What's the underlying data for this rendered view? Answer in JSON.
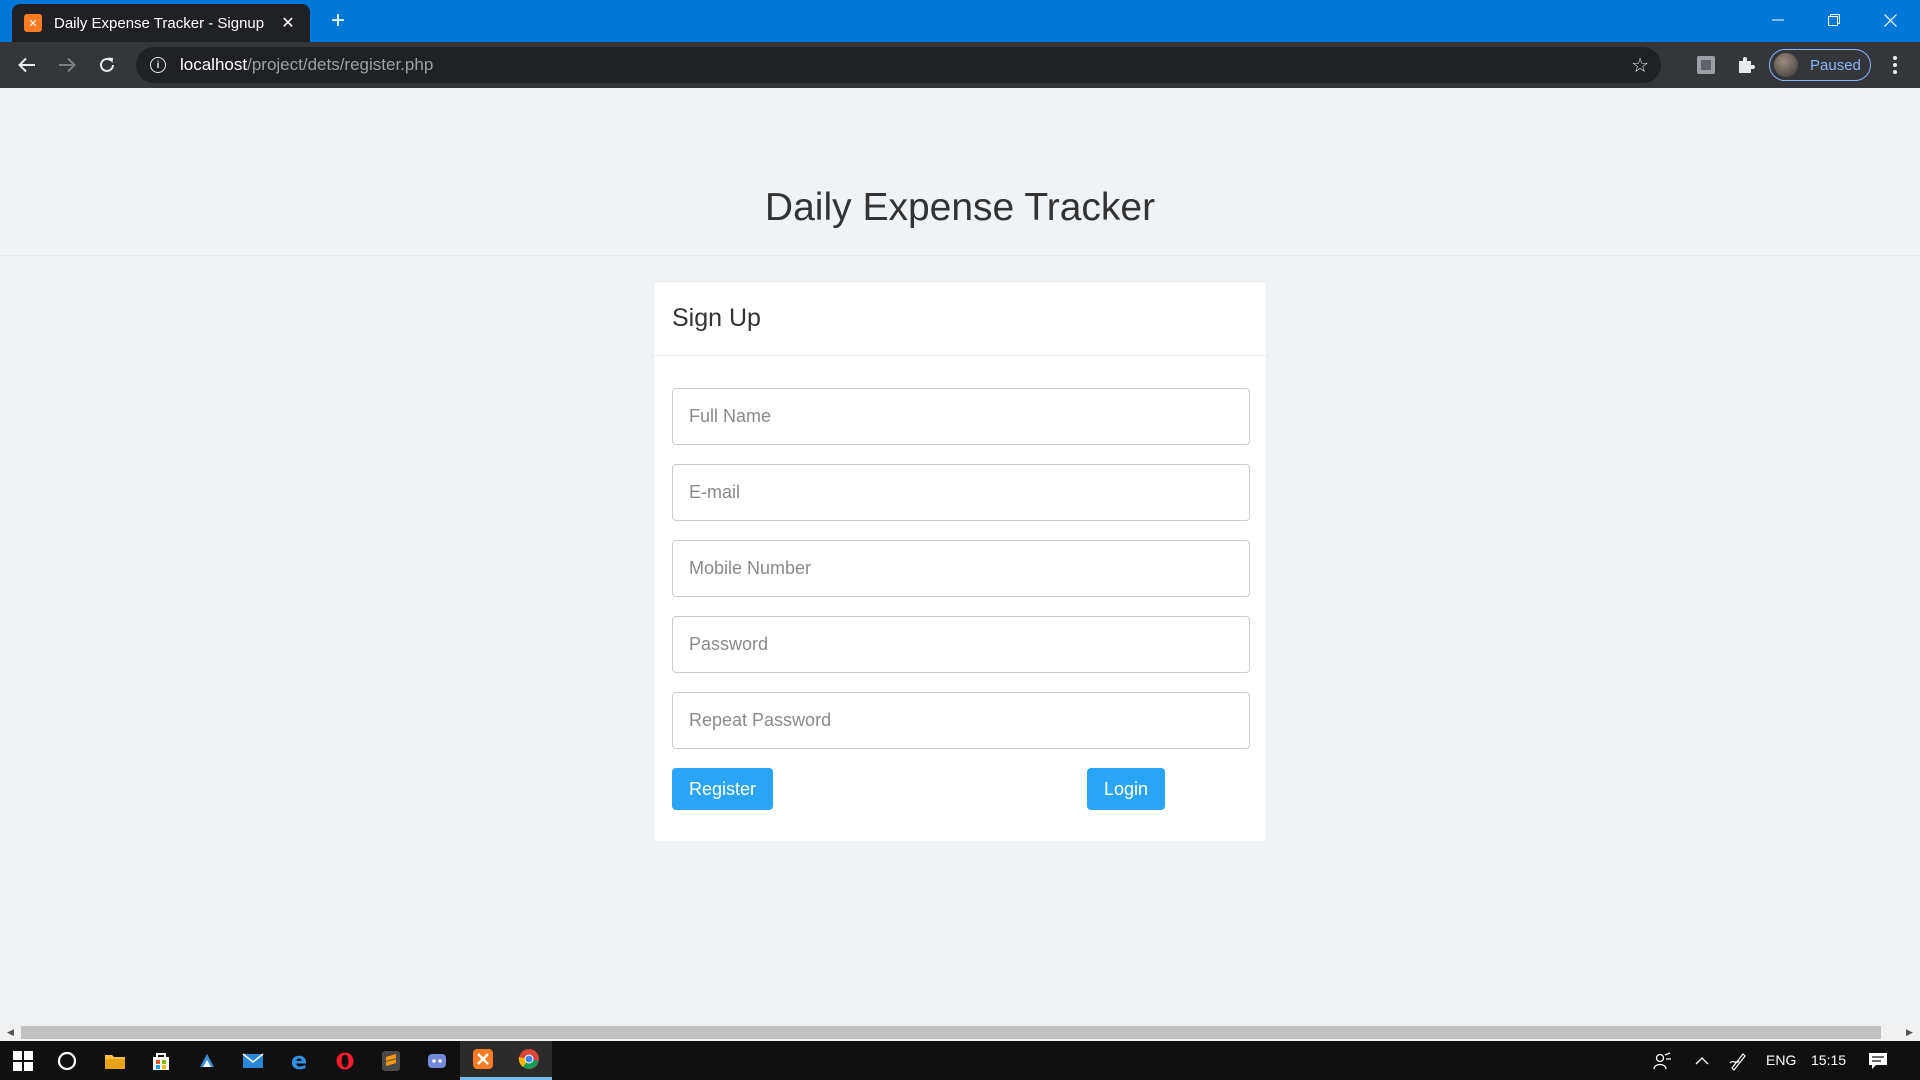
{
  "browser": {
    "tab_title": "Daily Expense Tracker - Signup",
    "url_host": "localhost",
    "url_path": "/project/dets/register.php",
    "profile_label": "Paused"
  },
  "page": {
    "site_title": "Daily Expense Tracker",
    "card_title": "Sign Up",
    "fields": {
      "full_name": "Full Name",
      "email": "E-mail",
      "mobile": "Mobile Number",
      "password": "Password",
      "repeat_password": "Repeat Password"
    },
    "register_label": "Register",
    "login_label": "Login"
  },
  "taskbar": {
    "language": "ENG",
    "time": "15:15"
  },
  "colors": {
    "title_bar": "#0078d7",
    "button": "#2aa4f4",
    "page_bg": "#f0f3f6"
  }
}
